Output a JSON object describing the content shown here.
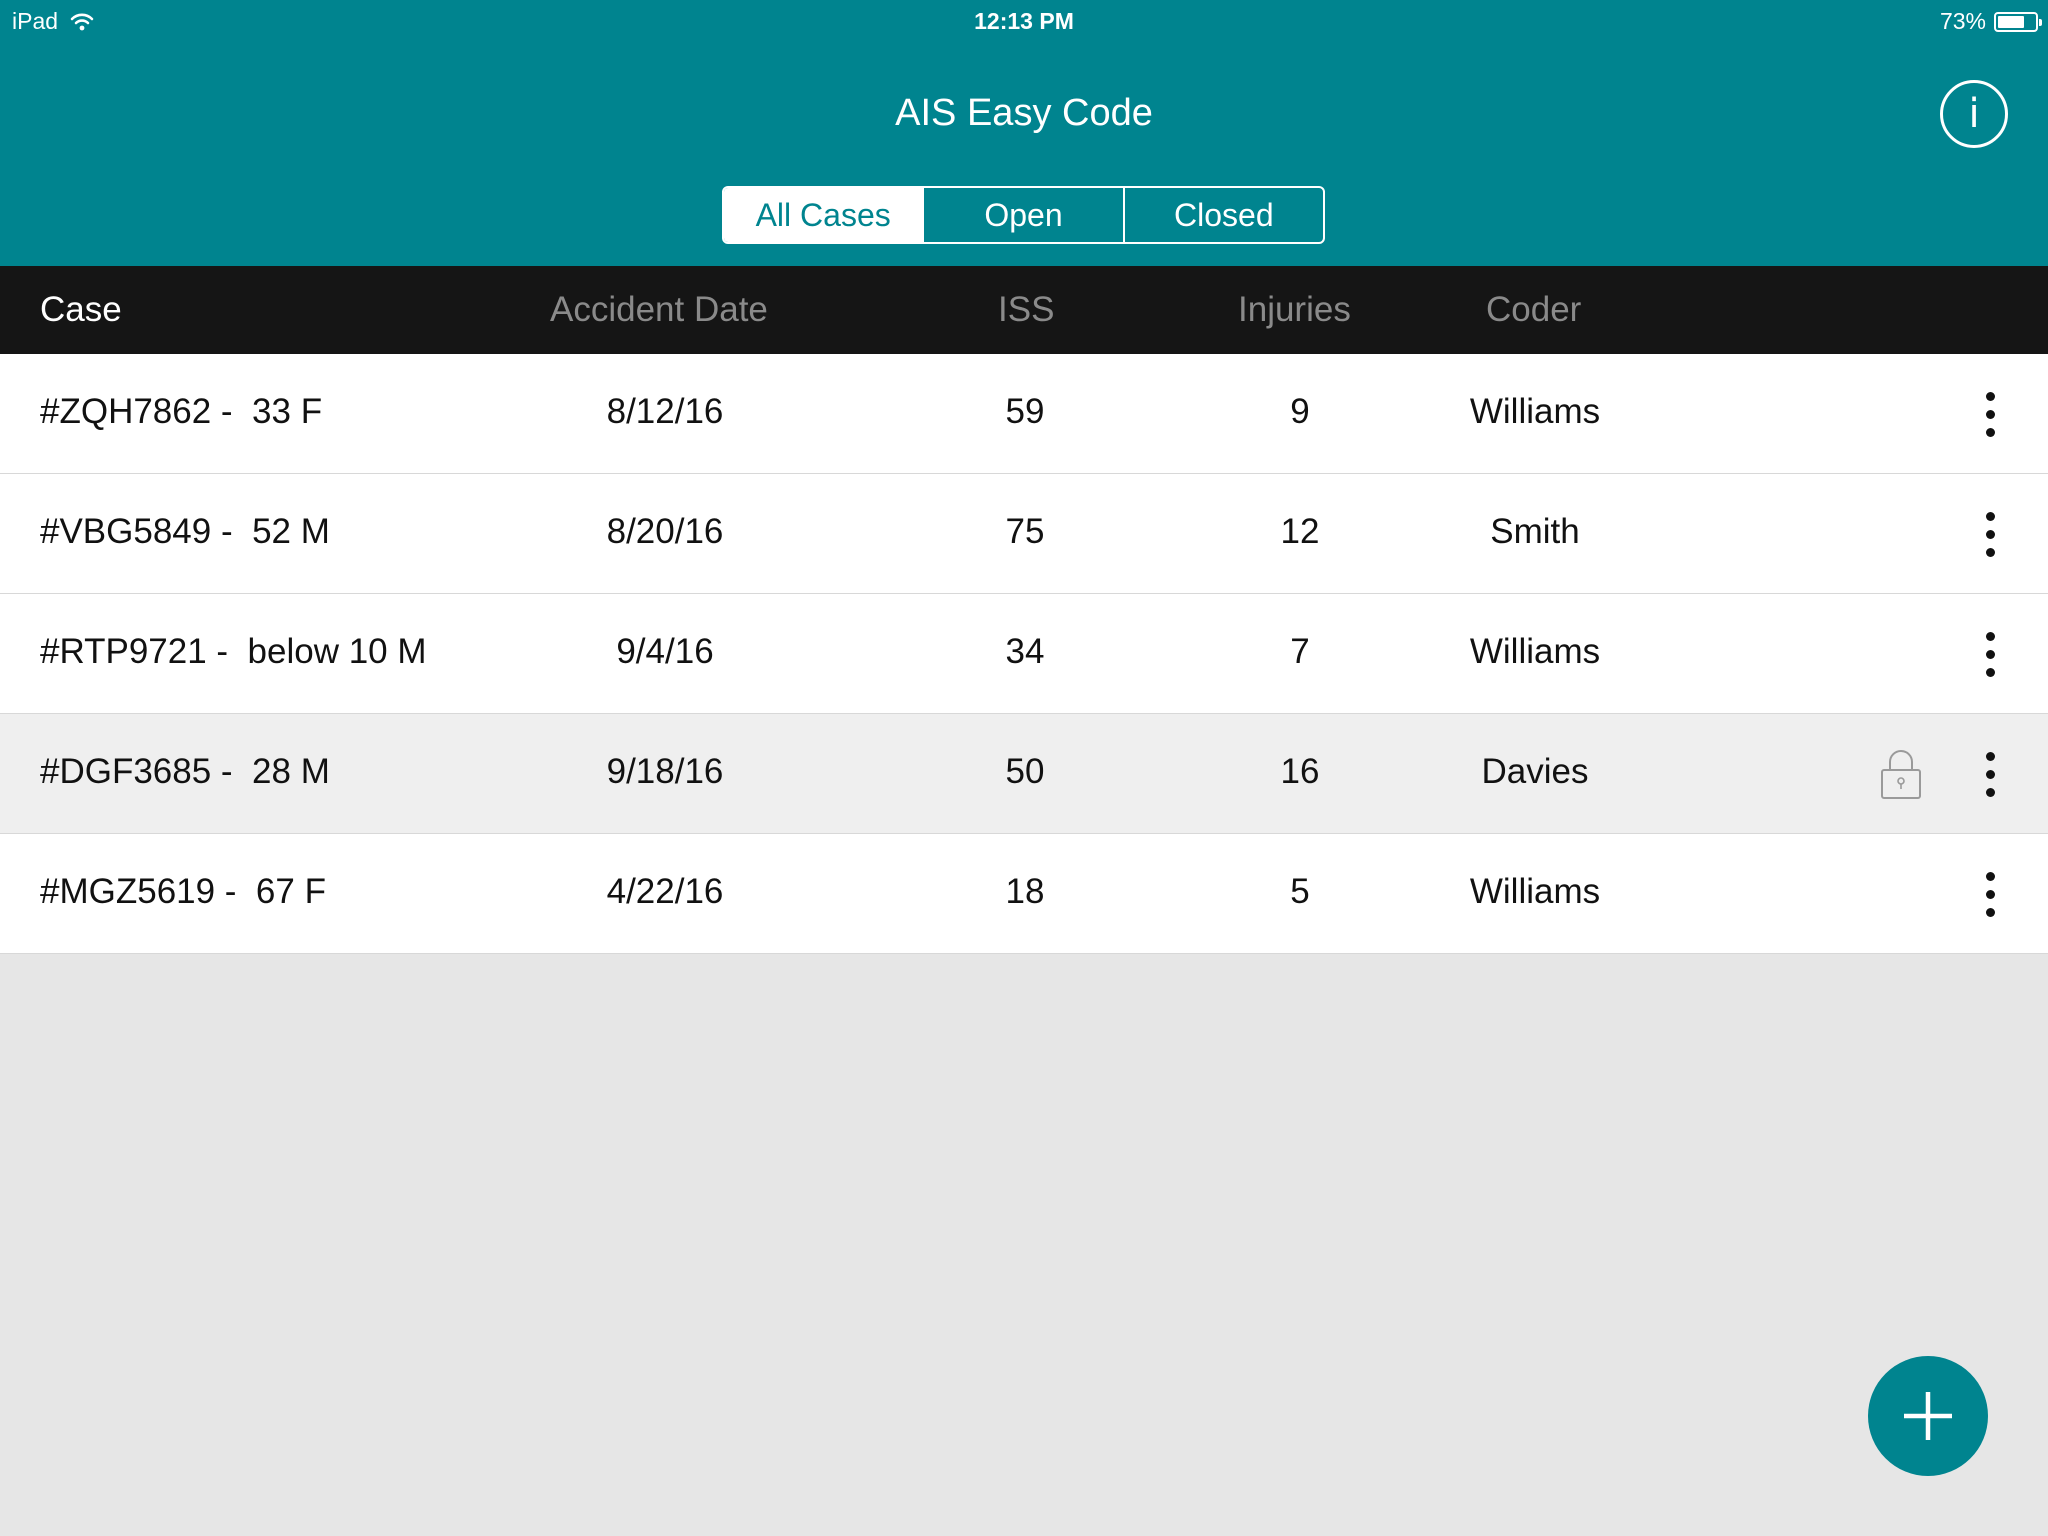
{
  "status_bar": {
    "carrier": "iPad",
    "time": "12:13 PM",
    "battery": "73%",
    "battery_level": 0.73
  },
  "header": {
    "title": "AIS Easy Code",
    "info_icon": "info-icon",
    "tabs": [
      {
        "label": "All Cases",
        "active": true
      },
      {
        "label": "Open",
        "active": false
      },
      {
        "label": "Closed",
        "active": false
      }
    ]
  },
  "table": {
    "columns": {
      "case": "Case",
      "accident_date": "Accident Date",
      "iss": "ISS",
      "injuries": "Injuries",
      "coder": "Coder"
    },
    "rows": [
      {
        "case": "#ZQH7862 -  33 F",
        "accident_date": "8/12/16",
        "iss": "59",
        "injuries": "9",
        "coder": "Williams",
        "locked": false
      },
      {
        "case": "#VBG5849 -  52 M",
        "accident_date": "8/20/16",
        "iss": "75",
        "injuries": "12",
        "coder": "Smith",
        "locked": false
      },
      {
        "case": "#RTP9721 -  below 10 M",
        "accident_date": "9/4/16",
        "iss": "34",
        "injuries": "7",
        "coder": "Williams",
        "locked": false
      },
      {
        "case": "#DGF3685 -  28 M",
        "accident_date": "9/18/16",
        "iss": "50",
        "injuries": "16",
        "coder": "Davies",
        "locked": true
      },
      {
        "case": "#MGZ5619 -  67 F",
        "accident_date": "4/22/16",
        "iss": "18",
        "injuries": "5",
        "coder": "Williams",
        "locked": false
      }
    ]
  },
  "fab": {
    "icon": "plus-icon"
  },
  "colors": {
    "brand": "#00848f",
    "header_bar": "#151515",
    "locked_row": "#efefef"
  }
}
